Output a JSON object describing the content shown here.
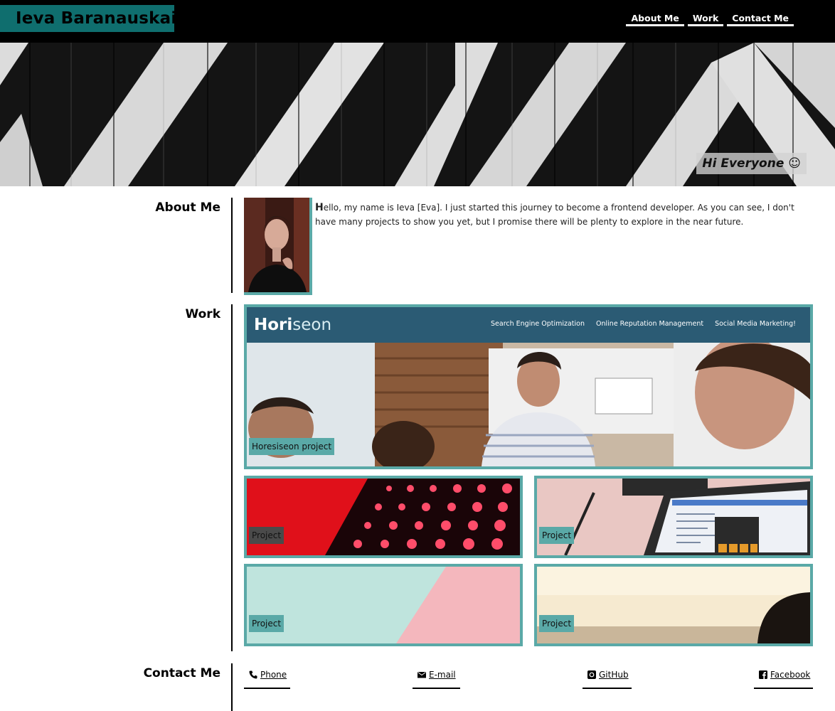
{
  "header": {
    "brand": "Ieva Baranauskaite",
    "nav": [
      {
        "label": "About Me"
      },
      {
        "label": "Work"
      },
      {
        "label": "Contact Me"
      }
    ]
  },
  "hero": {
    "greeting": "Hi Everyone ☺"
  },
  "sections": {
    "about": {
      "title": "About Me",
      "intro_first_letter": "H",
      "intro_rest": "ello, my name is Ieva [Eva]. I just started this journey to become a frontend developer. As you can see, I don't have many projects to show you yet, but I promise there will be plenty to explore in the near future."
    },
    "work": {
      "title": "Work",
      "featured": {
        "logo_a": "Hori",
        "logo_b": "seon",
        "nav": [
          "Search Engine Optimization",
          "Online Reputation Management",
          "Social Media Marketing!"
        ],
        "label": "Horesiseon project"
      },
      "projects": [
        {
          "label": "Project"
        },
        {
          "label": "Project"
        },
        {
          "label": "Project"
        },
        {
          "label": "Project"
        }
      ]
    },
    "contact": {
      "title": "Contact Me",
      "links": [
        {
          "label": "Phone",
          "icon": "phone-icon"
        },
        {
          "label": "E-mail",
          "icon": "envelope-icon"
        },
        {
          "label": "GitHub",
          "icon": "github-icon"
        },
        {
          "label": "Facebook",
          "icon": "facebook-icon"
        }
      ]
    }
  },
  "colors": {
    "accent": "#5aa9a7",
    "brand_bg": "#0f6e6e",
    "header_bg": "#000000",
    "horiseon_bar": "#2b5b74"
  }
}
